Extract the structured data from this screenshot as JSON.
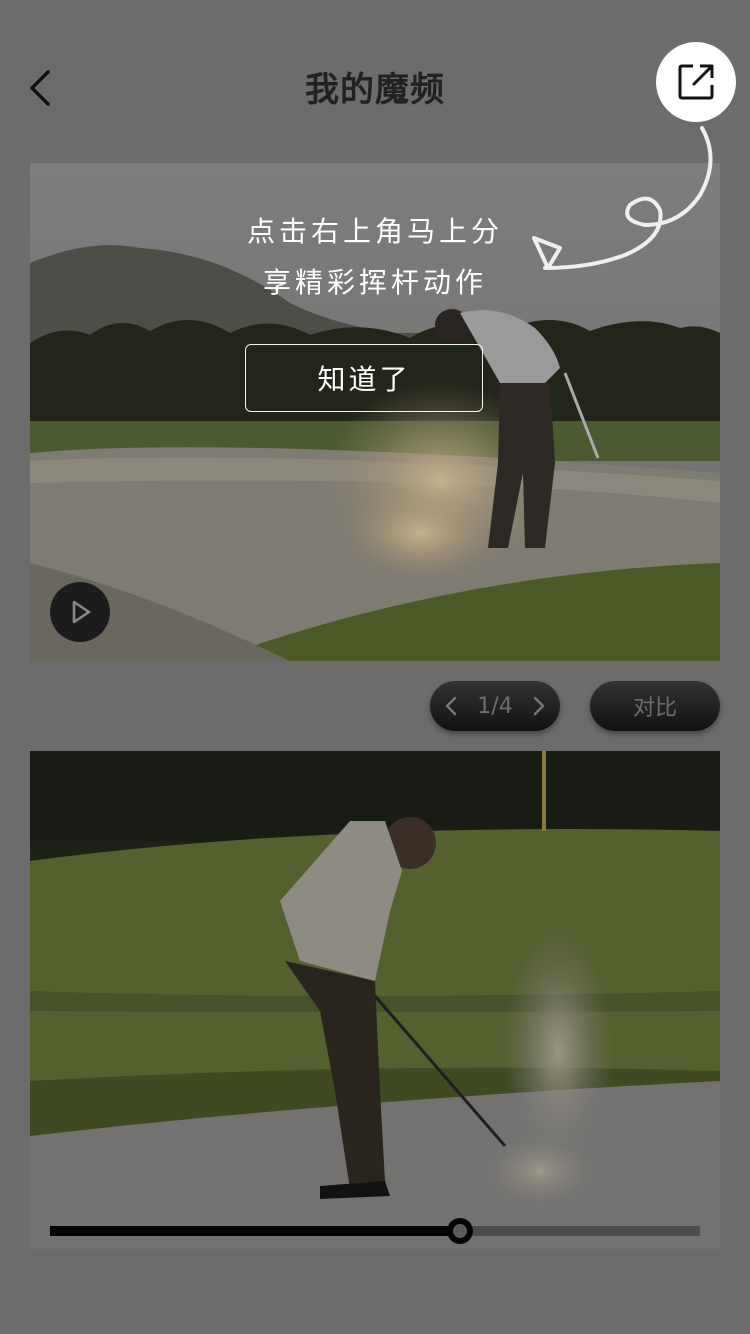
{
  "header": {
    "title": "我的魔频"
  },
  "guide": {
    "tip_line1": "点击右上角马上分",
    "tip_line2": "享精彩挥杆动作",
    "confirm_label": "知道了"
  },
  "compare_controls": {
    "page_indicator": "1/4",
    "compare_label": "对比"
  },
  "playback": {
    "progress": 0.63
  },
  "icons": {
    "back": "chevron-left-icon",
    "share": "share-external-icon",
    "play": "play-icon",
    "prev": "chevron-left-icon",
    "next": "chevron-right-icon",
    "hint_arrow": "curly-arrow-icon"
  }
}
